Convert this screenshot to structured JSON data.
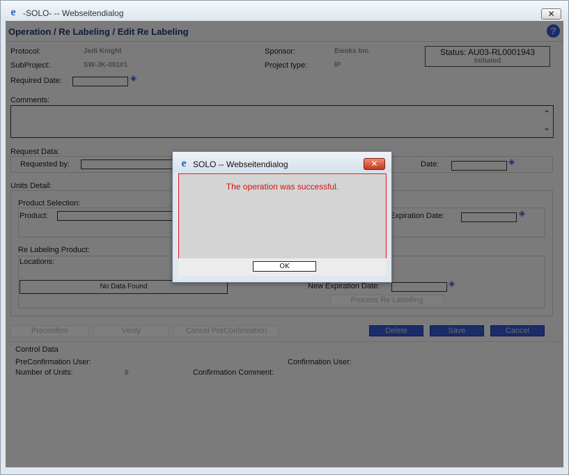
{
  "window": {
    "title": "-SOLO- -- Webseitendialog",
    "close_symbol": "✕"
  },
  "page": {
    "title": "Operation / Re Labeling / Edit Re Labeling",
    "help_symbol": "?"
  },
  "header": {
    "protocol_label": "Protocol:",
    "protocol_value": "Jedi Knight",
    "subproject_label": "SubProject:",
    "subproject_value": "SW-JK-001#1",
    "sponsor_label": "Sponsor:",
    "sponsor_value": "Ewoks Inc.",
    "project_type_label": "Project type:",
    "project_type_value": "IP",
    "required_date_label": "Required Date:",
    "required_date_value": "",
    "status_text": "Status: AU03-RL0001943",
    "status_state": "Initiated"
  },
  "comments": {
    "label": "Comments:",
    "value": ""
  },
  "request_data": {
    "label": "Request Data:",
    "requested_by_label": "Requested by:",
    "requested_by_value": "",
    "date_label": "Date:",
    "date_value": ""
  },
  "units_detail": {
    "label": "Units Detail:",
    "product_selection_label": "Product Selection:",
    "product_label": "Product:",
    "product_value": "",
    "expiration_date_label": "Expiration Date:",
    "expiration_date_value": "",
    "relabeling_product_label": "Re Labeling Product:",
    "locations_label": "Locations:",
    "no_data": "No Data Found",
    "new_expiration_date_label": "New Expiration Date:",
    "new_expiration_date_value": "",
    "process_button": "Process Re Labelling"
  },
  "actions": {
    "preconfirm": "Preconfirm",
    "verify": "Verify",
    "cancel_preconfirmation": "Cancel PreConfirmation",
    "delete": "Delete",
    "save": "Save",
    "cancel": "Cancel"
  },
  "control_data": {
    "label": "Control Data",
    "preconfirmation_user_label": "PreConfirmation User:",
    "confirmation_user_label": "Confirmation User:",
    "number_of_units_label": "Number of Units:",
    "number_of_units_value": "0",
    "confirmation_comment_label": "Confirmation Comment:"
  },
  "modal": {
    "title": "SOLO -- Webseitendialog",
    "message": "The operation was successful.",
    "ok": "OK",
    "close_symbol": "✕"
  },
  "icons": {
    "ie": "e",
    "calendar": "◈",
    "scroll_up": "⌃",
    "scroll_down": "⌄"
  },
  "colors": {
    "overlay_gray": "#7b7b7b",
    "navy_button": "#1b2c6a",
    "message_red": "#d61010"
  }
}
